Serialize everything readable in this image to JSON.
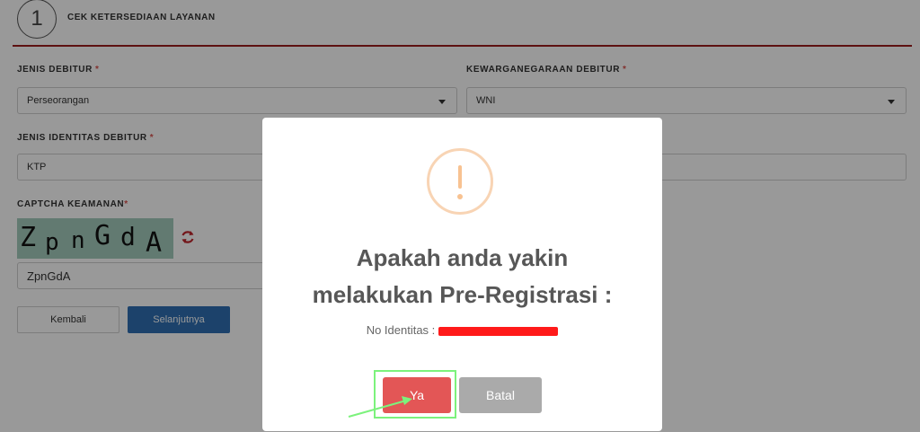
{
  "header": {
    "step_number": "1",
    "step_title": "CEK KETERSEDIAAN LAYANAN"
  },
  "form": {
    "jenis_debitur": {
      "label": "JENIS DEBITUR",
      "required_mark": "*",
      "value": "Perseorangan"
    },
    "kewarganegaraan": {
      "label": "KEWARGANEGARAAN DEBITUR",
      "required_mark": "*",
      "value": "WNI"
    },
    "jenis_identitas": {
      "label": "JENIS IDENTITAS DEBITUR",
      "required_mark": "*",
      "value": "KTP"
    },
    "captcha": {
      "label": "CAPTCHA KEAMANAN",
      "required_mark": "*",
      "image_text": [
        "Z",
        "p",
        "n",
        "G",
        "d",
        "A"
      ],
      "input_value": "ZpnGdA"
    },
    "buttons": {
      "back": "Kembali",
      "next": "Selanjutnya"
    }
  },
  "modal": {
    "title_line1": "Apakah anda yakin",
    "title_line2": "melakukan Pre-Registrasi :",
    "id_label": "No Identitas :",
    "confirm_label": "Ya",
    "cancel_label": "Batal",
    "icon": "warning-icon"
  },
  "colors": {
    "header_line": "#9b1c1c",
    "primary": "#2f6fb3",
    "danger": "#e35656",
    "warning": "#f8c291",
    "highlight": "#7cf27c"
  }
}
